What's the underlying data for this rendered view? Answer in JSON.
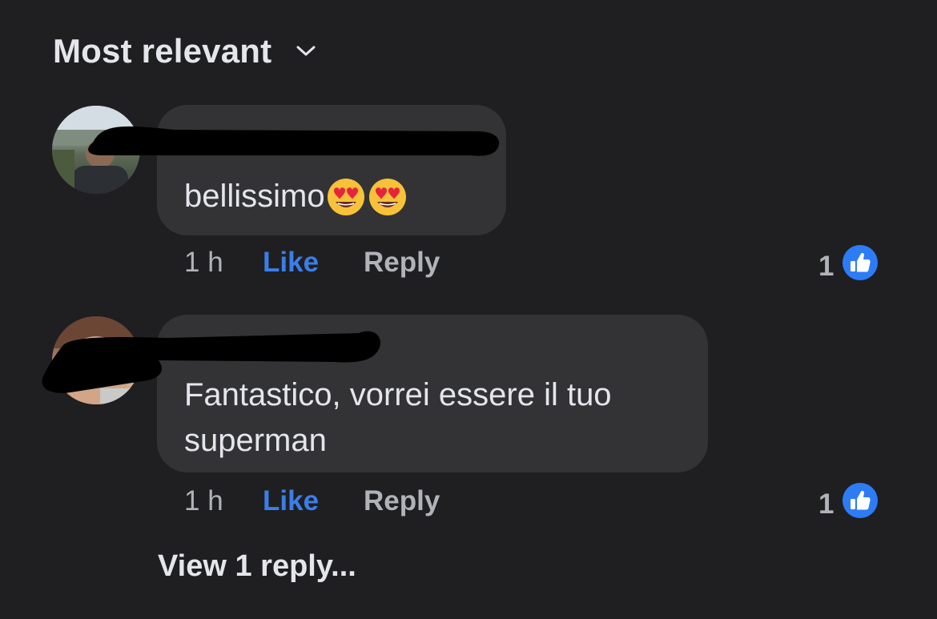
{
  "sort": {
    "label": "Most relevant",
    "icon": "chevron-down-icon"
  },
  "comments": [
    {
      "text": "bellissimo",
      "emojis": [
        "heart-eyes-emoji",
        "heart-eyes-emoji"
      ],
      "time": "1 h",
      "like_label": "Like",
      "reply_label": "Reply",
      "reaction_count": "1",
      "reaction_icon": "thumbs-up-icon"
    },
    {
      "text": "Fantastico, vorrei essere il tuo superman",
      "time": "1 h",
      "like_label": "Like",
      "reply_label": "Reply",
      "reaction_count": "1",
      "reaction_icon": "thumbs-up-icon"
    }
  ],
  "view_replies": "View 1 reply...",
  "colors": {
    "background": "#1f1f21",
    "bubble": "#333336",
    "like_blue": "#3b7ee8",
    "secondary_text": "#b0b3b8",
    "primary_text": "#e4e6eb"
  }
}
